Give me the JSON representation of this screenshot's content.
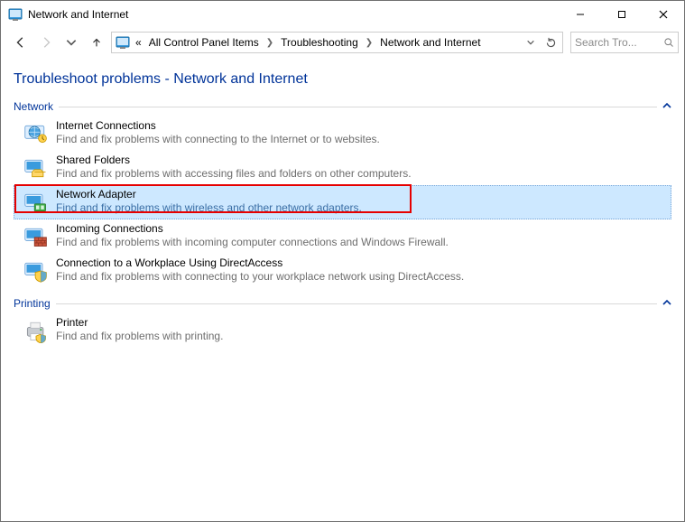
{
  "window": {
    "title": "Network and Internet"
  },
  "breadcrumbs": {
    "prefix": "«",
    "items": [
      "All Control Panel Items",
      "Troubleshooting",
      "Network and Internet"
    ]
  },
  "search": {
    "placeholder": "Search Tro..."
  },
  "page": {
    "title": "Troubleshoot problems - Network and Internet"
  },
  "sections": [
    {
      "name": "Network",
      "items": [
        {
          "id": "internet-connections",
          "title": "Internet Connections",
          "desc": "Find and fix problems with connecting to the Internet or to websites.",
          "selected": false
        },
        {
          "id": "shared-folders",
          "title": "Shared Folders",
          "desc": "Find and fix problems with accessing files and folders on other computers.",
          "selected": false
        },
        {
          "id": "network-adapter",
          "title": "Network Adapter",
          "desc": "Find and fix problems with wireless and other network adapters.",
          "selected": true
        },
        {
          "id": "incoming-connections",
          "title": "Incoming Connections",
          "desc": "Find and fix problems with incoming computer connections and Windows Firewall.",
          "selected": false
        },
        {
          "id": "directaccess",
          "title": "Connection to a Workplace Using DirectAccess",
          "desc": "Find and fix problems with connecting to your workplace network using DirectAccess.",
          "selected": false
        }
      ]
    },
    {
      "name": "Printing",
      "items": [
        {
          "id": "printer",
          "title": "Printer",
          "desc": "Find and fix problems with printing.",
          "selected": false
        }
      ]
    }
  ],
  "icons": {
    "internet-connections": "globe",
    "shared-folders": "folder-monitor",
    "network-adapter": "adapter",
    "incoming-connections": "firewall",
    "directaccess": "monitor-shield",
    "printer": "printer"
  }
}
